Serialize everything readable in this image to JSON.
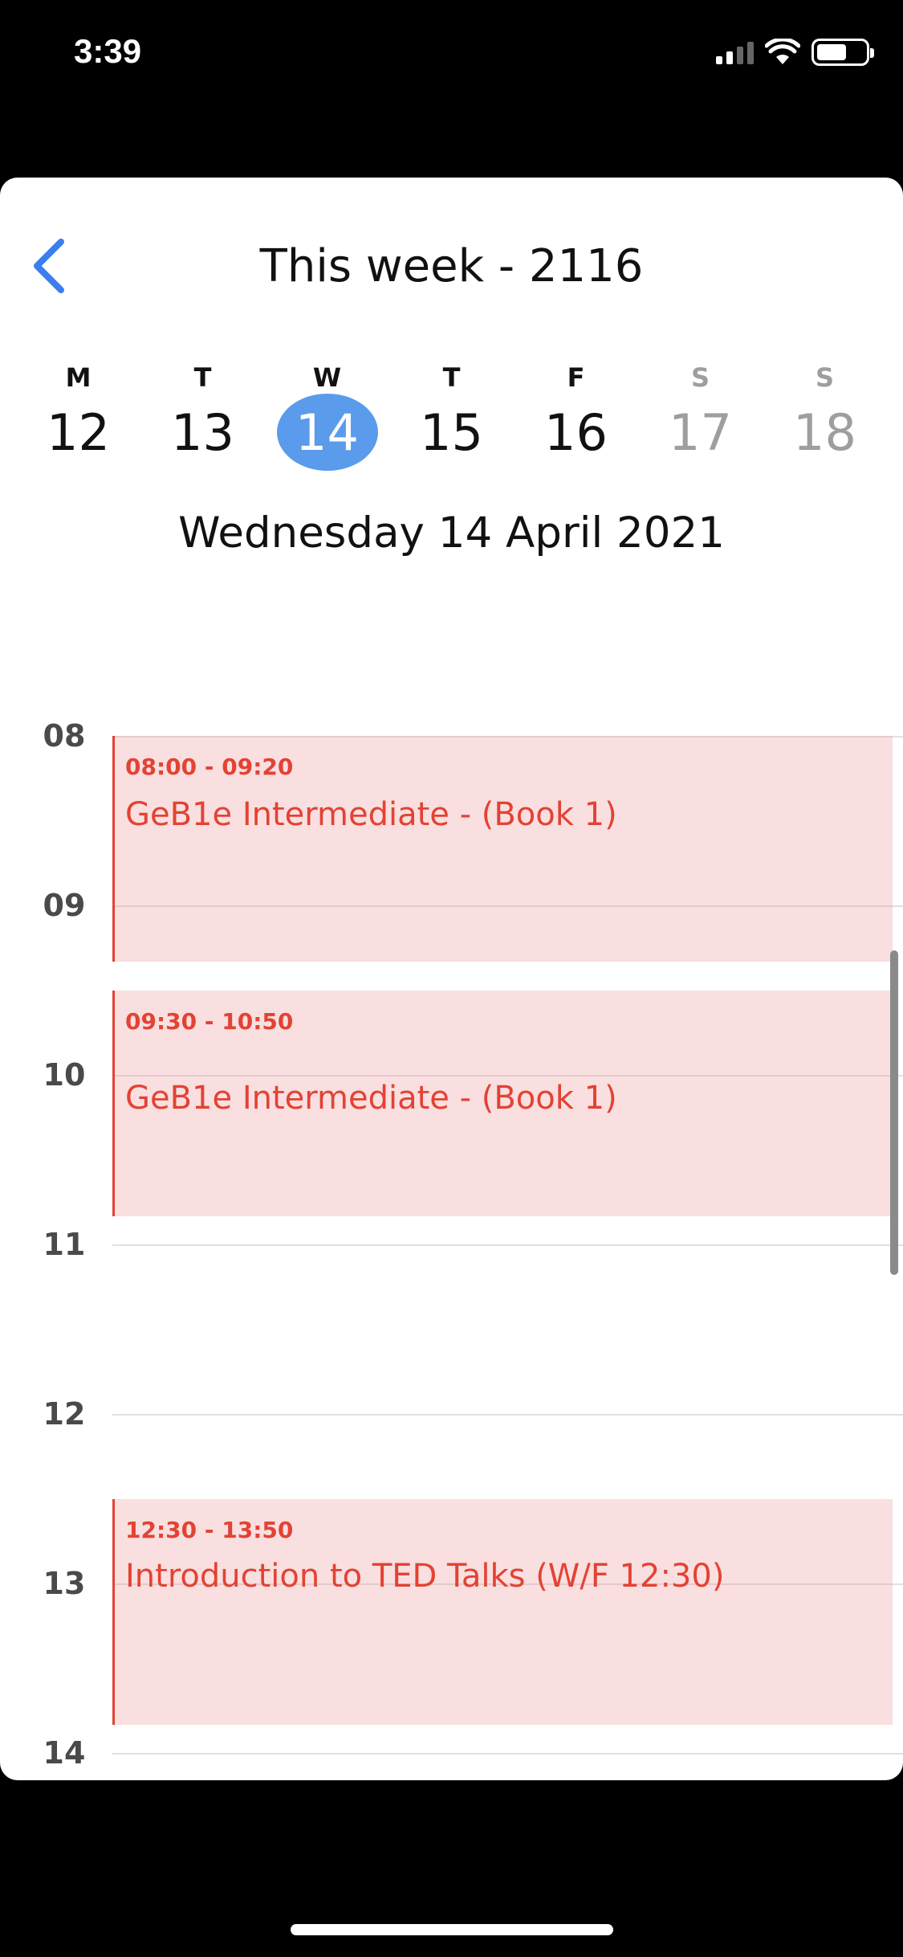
{
  "status_bar": {
    "time": "3:39",
    "icons": [
      "cellular-signal-icon",
      "wifi-icon",
      "battery-icon"
    ],
    "battery_level": 0.62
  },
  "header": {
    "back_icon": "chevron-left-icon",
    "title": "This week - 2116"
  },
  "week": {
    "days": [
      {
        "letter": "M",
        "number": "12"
      },
      {
        "letter": "T",
        "number": "13"
      },
      {
        "letter": "W",
        "number": "14"
      },
      {
        "letter": "T",
        "number": "15"
      },
      {
        "letter": "F",
        "number": "16"
      },
      {
        "letter": "S",
        "number": "17"
      },
      {
        "letter": "S",
        "number": "18"
      }
    ],
    "selected_index": 2
  },
  "selected_date_label": "Wednesday 14 April 2021",
  "timeline": {
    "hours": [
      "08",
      "09",
      "10",
      "11",
      "12",
      "13",
      "14"
    ]
  },
  "events": [
    {
      "time": "08:00 - 09:20",
      "title": "GeB1e Intermediate - (Book 1)"
    },
    {
      "time": "09:30 - 10:50",
      "title": "GeB1e Intermediate - (Book 1)"
    },
    {
      "time": "12:30 - 13:50",
      "title": "Introduction to TED Talks (W/F 12:30)"
    }
  ],
  "colors": {
    "accent": "#5b9bec",
    "back_arrow": "#3a7ff0",
    "event_text": "#e34234",
    "event_bg": "#f9dfdf"
  }
}
